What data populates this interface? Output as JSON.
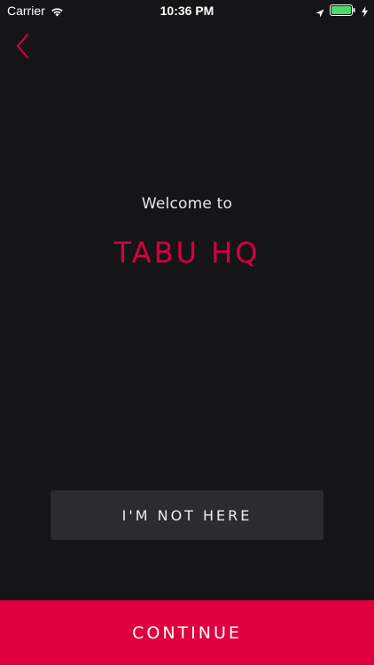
{
  "status_bar": {
    "carrier": "Carrier",
    "time": "10:36 PM",
    "icons": [
      "wifi-icon",
      "location-arrow-icon",
      "battery-icon",
      "charging-bolt-icon"
    ],
    "battery_color": "#4cd964"
  },
  "nav": {
    "back_icon": "chevron-left-icon"
  },
  "main": {
    "welcome_label": "Welcome to",
    "location_name": "TABU HQ"
  },
  "buttons": {
    "not_here_label": "I'M NOT HERE",
    "continue_label": "CONTINUE"
  },
  "colors": {
    "background": "#151517",
    "accent": "#e0003f",
    "secondary_button": "#2a2c31"
  }
}
